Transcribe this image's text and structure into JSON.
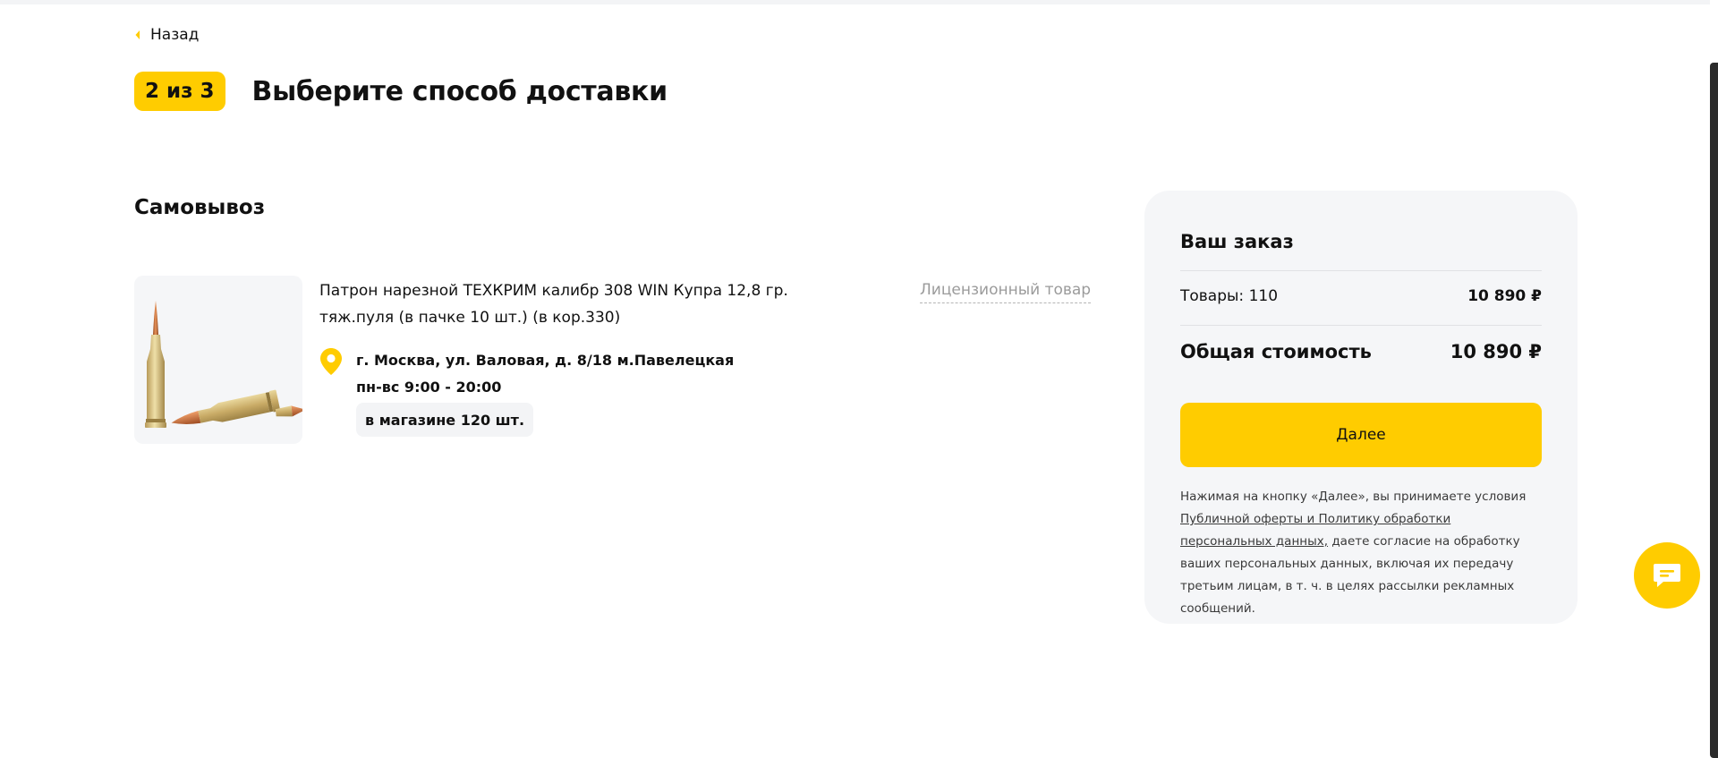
{
  "nav": {
    "back_label": "Назад"
  },
  "step": {
    "badge": "2 из 3",
    "title": "Выберите способ доставки"
  },
  "pickup": {
    "section_title": "Самовывоз",
    "product": {
      "name": "Патрон нарезной ТЕХКРИМ калибр 308 WIN Купра 12,8 гр. тяж.пуля (в пачке 10 шт.) (в кор.330)",
      "license_label": "Лицензионный товар"
    },
    "store": {
      "address": "г. Москва, ул. Валовая, д. 8/18 м.Павелецкая",
      "hours": "пн-вс 9:00 - 20:00",
      "stock": "в магазине 120 шт."
    }
  },
  "order": {
    "title": "Ваш заказ",
    "goods_label": "Товары: 110",
    "goods_value": "10 890 ₽",
    "total_label": "Общая стоимость",
    "total_value": "10 890 ₽",
    "next_button": "Далее",
    "consent": {
      "before": "Нажимая на кнопку «Далее», вы принимаете условия ",
      "link": "Публичной оферты и Политику обработки персональных данных,",
      "after": " даете согласие на обработку ваших персональных данных, включая их передачу третьим лицам, в т. ч. в целях рассылки рекламных сообщений."
    }
  },
  "icons": {
    "back": "chevron-left-icon",
    "location": "map-pin-icon",
    "chat": "chat-icon",
    "product_image": "cartridge-image"
  },
  "colors": {
    "accent": "#ffcc00",
    "panel": "#f5f6f8",
    "muted": "#9b9b9b"
  }
}
